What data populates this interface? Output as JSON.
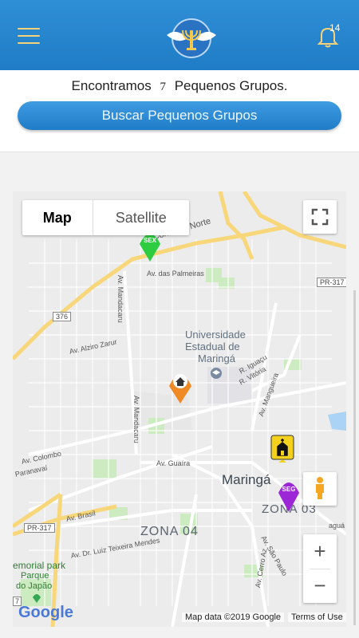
{
  "app": {
    "notification_count": "14"
  },
  "icons": {
    "menu": "hamburger-menu-icon",
    "logo": "menorah-doves-logo",
    "bell": "bell-icon",
    "fullscreen": "fullscreen-icon",
    "pegman": "pegman-icon",
    "church": "church-icon",
    "home": "home-icon"
  },
  "summary": {
    "prefix": "Encontramos",
    "count": "7",
    "suffix": "Pequenos Grupos."
  },
  "search_button": "Buscar Pequenos Grupos",
  "map": {
    "type_map": "Map",
    "type_satellite": "Satellite",
    "zoom_in": "+",
    "zoom_out": "−",
    "attribution": "Map data ©2019 Google",
    "terms": "Terms of Use",
    "google_logo": "Google",
    "labels": {
      "contorno_norte": "Contorno Norte",
      "palmeiras": "Av. das Palmeiras",
      "pr317_top": "PR-317",
      "pr317_bottom": "PR-317",
      "r376": "376",
      "mandacaru_1": "Av. Mandacaru",
      "mandacaru_2": "Av. Mandacaru",
      "zarur": "Av. Alziro Zarur",
      "university_1": "Universidade",
      "university_2": "Estadual de",
      "university_3": "Maringá",
      "iguacu": "R. Iguaçu",
      "vitoria": "R. Vitória",
      "mangueira": "Av. Mangueira",
      "colombo": "Av. Colombo",
      "paranavai": "Paranavaí",
      "guaira": "Av. Guaíra",
      "maringa": "Maringá",
      "zona03": "ZONA 03",
      "zona04": "ZONA 04",
      "brasil": "Av. Brasil",
      "teixeira": "Av. Dr. Luiz Teixeira Mendes",
      "memorial": "emorial park",
      "parque_1": "Parque",
      "parque_2": "do Japão",
      "saopaulo": "Av. São Paulo",
      "cerroazul": "Av. Cerro Az",
      "aguaria": "aguá",
      "num7": "7"
    },
    "markers": {
      "sex": "SEX",
      "seg": "SEG"
    },
    "colors": {
      "marker_green": "#2ecc40",
      "marker_purple": "#9b27d6",
      "marker_orange": "#f08a24",
      "marker_yellow": "#f4d11c",
      "highway": "#f8d77a",
      "park": "#cdebc0"
    }
  }
}
